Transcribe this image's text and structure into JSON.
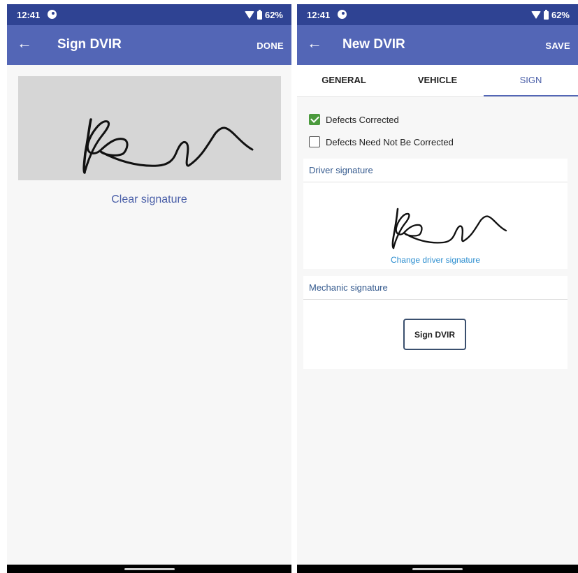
{
  "status_bar": {
    "time": "12:41",
    "battery": "62%"
  },
  "left_screen": {
    "app_bar": {
      "title": "Sign DVIR",
      "action": "DONE",
      "back_icon": "arrow-left-icon"
    },
    "clear_signature_label": "Clear signature"
  },
  "right_screen": {
    "app_bar": {
      "title": "New DVIR",
      "action": "SAVE",
      "back_icon": "arrow-left-icon"
    },
    "tabs": [
      {
        "label": "GENERAL",
        "active": false
      },
      {
        "label": "VEHICLE",
        "active": false
      },
      {
        "label": "SIGN",
        "active": true
      }
    ],
    "checkboxes": [
      {
        "label": "Defects Corrected",
        "checked": true
      },
      {
        "label": "Defects Need Not Be Corrected",
        "checked": false
      }
    ],
    "driver_signature": {
      "header": "Driver signature",
      "link": "Change driver signature"
    },
    "mechanic_signature": {
      "header": "Mechanic signature",
      "button": "Sign DVIR"
    }
  },
  "colors": {
    "status_bar": "#2f4393",
    "app_bar": "#5366b6",
    "checked": "#4b9a3d",
    "link": "#2e8fd0"
  }
}
